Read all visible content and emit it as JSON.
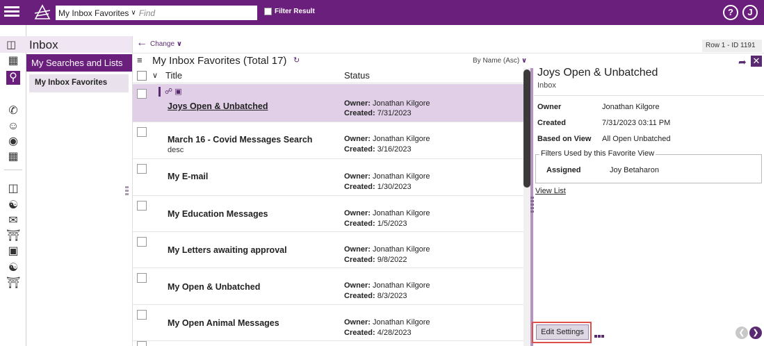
{
  "topbar": {
    "search_scope": "My Inbox Favorites",
    "search_placeholder": "Find",
    "filter_result_label": "Filter Result",
    "help_label": "?",
    "user_label": "J",
    "colors": {
      "brand": "#6b1f7c",
      "accent": "#5a2a70"
    }
  },
  "sidebar": {
    "inbox_title": "Inbox",
    "searches_header": "My Searches and Lists",
    "items": [
      {
        "label": "My Inbox Favorites",
        "selected": true
      }
    ],
    "rail_icons": [
      "grid-list-icon",
      "search-icon",
      "phone-add-icon",
      "person-add-icon",
      "pin-add-icon",
      "calendar-icon",
      "inbox-icon",
      "people-icon",
      "mail-icon",
      "bank-icon",
      "building-icon",
      "people-search-icon",
      "bank-search-icon"
    ]
  },
  "toolbar": {
    "change_label": "Change",
    "row_id": "Row 1 - ID 1191"
  },
  "list": {
    "title": "My Inbox Favorites (Total 17)",
    "sort_label": "By Name (Asc)",
    "columns": {
      "title": "Title",
      "status": "Status"
    },
    "owner_label": "Owner:",
    "created_label": "Created:",
    "rows": [
      {
        "title": "Joys Open & Unbatched",
        "desc": "",
        "owner": "Jonathan Kilgore",
        "created": "7/31/2023",
        "selected": true
      },
      {
        "title": "March 16 - Covid Messages Search",
        "desc": "desc",
        "owner": "Jonathan Kilgore",
        "created": "3/16/2023"
      },
      {
        "title": "My E-mail",
        "desc": "",
        "owner": "Jonathan Kilgore",
        "created": "1/30/2023"
      },
      {
        "title": "My Education Messages",
        "desc": "",
        "owner": "Jonathan Kilgore",
        "created": "1/5/2023"
      },
      {
        "title": "My Letters awaiting approval",
        "desc": "",
        "owner": "Jonathan Kilgore",
        "created": "9/8/2022"
      },
      {
        "title": "My Open & Unbatched",
        "desc": "",
        "owner": "Jonathan Kilgore",
        "created": "8/3/2023"
      },
      {
        "title": "My Open Animal Messages",
        "desc": "",
        "owner": "Jonathan Kilgore",
        "created": "4/28/2023"
      }
    ]
  },
  "detail": {
    "title": "Joys Open & Unbatched",
    "subtitle": "Inbox",
    "owner_label": "Owner",
    "owner_value": "Jonathan Kilgore",
    "created_label": "Created",
    "created_value": "7/31/2023 03:11 PM",
    "based_on_label": "Based on View",
    "based_on_value": "All Open Unbatched",
    "filters_legend": "Filters Used by this Favorite View",
    "assigned_label": "Assigned",
    "assigned_value": "Joy Betaharon",
    "view_list_label": "View List",
    "edit_settings_label": "Edit Settings"
  }
}
